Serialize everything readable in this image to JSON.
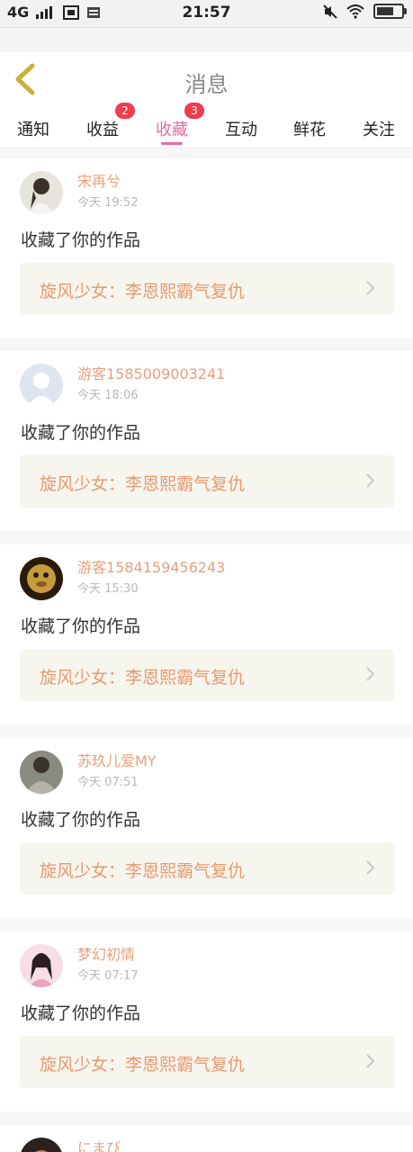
{
  "status_bar": {
    "network": "4G",
    "sim_icon": "sim-card-icon",
    "time": "21:57"
  },
  "header": {
    "title": "消息",
    "back_icon": "chevron-left-icon"
  },
  "tabs": [
    {
      "label": "通知"
    },
    {
      "label": "收益",
      "badge": "2"
    },
    {
      "label": "收藏",
      "badge": "3",
      "active": true
    },
    {
      "label": "互动"
    },
    {
      "label": "鲜花"
    },
    {
      "label": "关注"
    }
  ],
  "colors": {
    "accent": "#e56aa6",
    "badge": "#f23b4d",
    "name": "#e8a07a",
    "work_title": "#ea9a6c",
    "work_bg": "#f6f5ee"
  },
  "messages": [
    {
      "name": "宋再兮",
      "time": "今天 19:52",
      "action": "收藏了你的作品",
      "work_title": "旋风少女：李恩熙霸气复仇"
    },
    {
      "name": "游客1585009003241",
      "time": "今天 18:06",
      "action": "收藏了你的作品",
      "work_title": "旋风少女：李恩熙霸气复仇"
    },
    {
      "name": "游客1584159456243",
      "time": "今天 15:30",
      "action": "收藏了你的作品",
      "work_title": "旋风少女：李恩熙霸气复仇"
    },
    {
      "name": "苏玖儿爱MY",
      "time": "今天 07:51",
      "action": "收藏了你的作品",
      "work_title": "旋风少女：李恩熙霸气复仇"
    },
    {
      "name": "梦幻初情",
      "time": "今天 07:17",
      "action": "收藏了你的作品",
      "work_title": "旋风少女：李恩熙霸气复仇"
    },
    {
      "name": "にまび"
    }
  ]
}
